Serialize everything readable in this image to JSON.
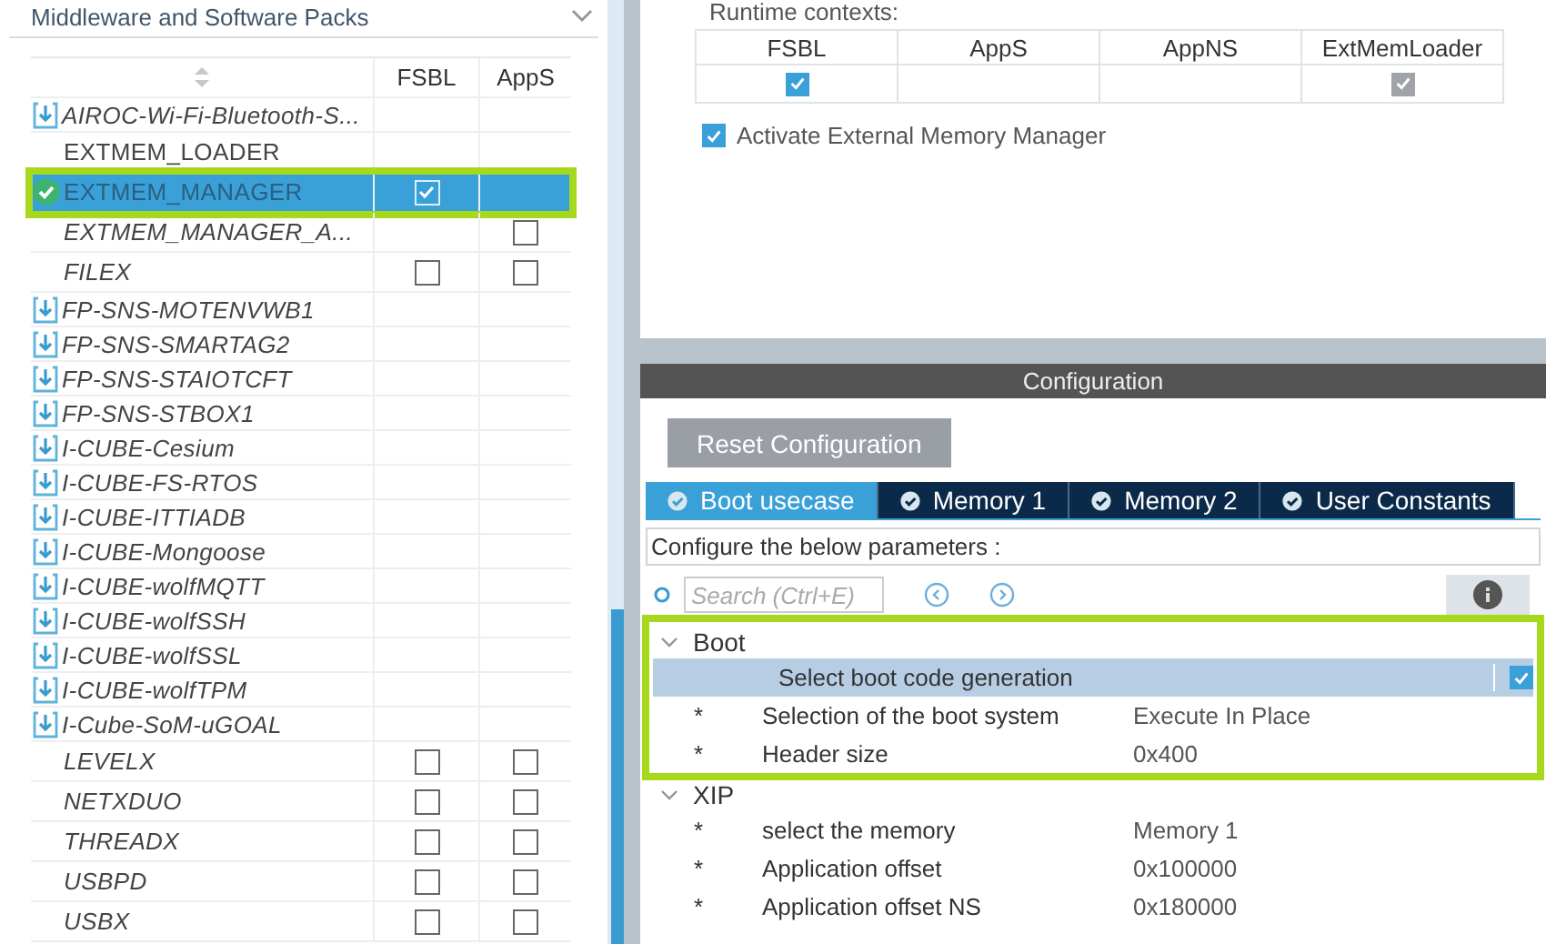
{
  "left_panel": {
    "title": "Middleware and Software Packs",
    "table": {
      "columns": [
        "FSBL",
        "AppS"
      ],
      "rows": [
        {
          "name": "AIROC-Wi-Fi-Bluetooth-S...",
          "kind": "pack",
          "italic": true,
          "selected": false,
          "highlighted": false
        },
        {
          "name": "EXTMEM_LOADER",
          "kind": "component",
          "italic": false,
          "selected": false,
          "highlighted": false
        },
        {
          "name": "EXTMEM_MANAGER",
          "kind": "active_component",
          "italic": false,
          "selected": true,
          "highlighted": true,
          "fsbl_checked": true
        },
        {
          "name": "EXTMEM_MANAGER_A...",
          "kind": "component",
          "italic": true,
          "selected": false,
          "highlighted": false,
          "apps_checked": false
        },
        {
          "name": "FILEX",
          "kind": "component",
          "italic": true,
          "selected": false,
          "highlighted": false,
          "fsbl_checked": false,
          "apps_checked": false
        },
        {
          "name": "FP-SNS-MOTENVWB1",
          "kind": "pack",
          "italic": true,
          "selected": false,
          "highlighted": false
        },
        {
          "name": "FP-SNS-SMARTAG2",
          "kind": "pack",
          "italic": true,
          "selected": false,
          "highlighted": false
        },
        {
          "name": "FP-SNS-STAIOTCFT",
          "kind": "pack",
          "italic": true,
          "selected": false,
          "highlighted": false
        },
        {
          "name": "FP-SNS-STBOX1",
          "kind": "pack",
          "italic": true,
          "selected": false,
          "highlighted": false
        },
        {
          "name": "I-CUBE-Cesium",
          "kind": "pack",
          "italic": true,
          "selected": false,
          "highlighted": false
        },
        {
          "name": "I-CUBE-FS-RTOS",
          "kind": "pack",
          "italic": true,
          "selected": false,
          "highlighted": false
        },
        {
          "name": "I-CUBE-ITTIADB",
          "kind": "pack",
          "italic": true,
          "selected": false,
          "highlighted": false
        },
        {
          "name": "I-CUBE-Mongoose",
          "kind": "pack",
          "italic": true,
          "selected": false,
          "highlighted": false
        },
        {
          "name": "I-CUBE-wolfMQTT",
          "kind": "pack",
          "italic": true,
          "selected": false,
          "highlighted": false
        },
        {
          "name": "I-CUBE-wolfSSH",
          "kind": "pack",
          "italic": true,
          "selected": false,
          "highlighted": false
        },
        {
          "name": "I-CUBE-wolfSSL",
          "kind": "pack",
          "italic": true,
          "selected": false,
          "highlighted": false
        },
        {
          "name": "I-CUBE-wolfTPM",
          "kind": "pack",
          "italic": true,
          "selected": false,
          "highlighted": false
        },
        {
          "name": "I-Cube-SoM-uGOAL",
          "kind": "pack",
          "italic": true,
          "selected": false,
          "highlighted": false
        },
        {
          "name": "LEVELX",
          "kind": "component",
          "italic": true,
          "selected": false,
          "highlighted": false,
          "fsbl_checked": false,
          "apps_checked": false
        },
        {
          "name": "NETXDUO",
          "kind": "component",
          "italic": true,
          "selected": false,
          "highlighted": false,
          "fsbl_checked": false,
          "apps_checked": false
        },
        {
          "name": "THREADX",
          "kind": "component",
          "italic": true,
          "selected": false,
          "highlighted": false,
          "fsbl_checked": false,
          "apps_checked": false
        },
        {
          "name": "USBPD",
          "kind": "component",
          "italic": true,
          "selected": false,
          "highlighted": false,
          "fsbl_checked": false,
          "apps_checked": false
        },
        {
          "name": "USBX",
          "kind": "component",
          "italic": true,
          "selected": false,
          "highlighted": false,
          "fsbl_checked": false,
          "apps_checked": false
        }
      ]
    }
  },
  "runtime": {
    "label": "Runtime contexts:",
    "columns": [
      "FSBL",
      "AppS",
      "AppNS",
      "ExtMemLoader"
    ],
    "cells": [
      {
        "kind": "checkbox",
        "checked": true,
        "disabled": false
      },
      {
        "kind": "empty"
      },
      {
        "kind": "empty"
      },
      {
        "kind": "checkbox",
        "checked": true,
        "disabled": true
      }
    ]
  },
  "activate": {
    "label": "Activate External Memory Manager",
    "checked": true
  },
  "configuration": {
    "title": "Configuration",
    "reset_button": "Reset Configuration",
    "tabs": [
      {
        "label": "Boot usecase",
        "selected": true
      },
      {
        "label": "Memory 1",
        "selected": false
      },
      {
        "label": "Memory 2",
        "selected": false
      },
      {
        "label": "User Constants",
        "selected": false
      }
    ],
    "hint": "Configure the below parameters :",
    "search": {
      "placeholder": "Search (Ctrl+E)"
    },
    "groups": [
      {
        "label": "Boot",
        "expanded": true,
        "highlighted": true,
        "params": [
          {
            "label": "Select boot code generation",
            "kind": "checkbox",
            "checked": true,
            "selected": true
          },
          {
            "marker": "*",
            "label": "Selection of the boot system",
            "kind": "text",
            "value": "Execute In Place",
            "selected": false
          },
          {
            "marker": "*",
            "label": "Header size",
            "kind": "text",
            "value": "0x400",
            "selected": false
          }
        ]
      },
      {
        "label": "XIP",
        "expanded": true,
        "highlighted": false,
        "params": [
          {
            "marker": "*",
            "label": "select the memory",
            "kind": "text",
            "value": "Memory 1",
            "selected": false
          },
          {
            "marker": "*",
            "label": "Application offset",
            "kind": "text",
            "value": "0x100000",
            "selected": false
          },
          {
            "marker": "*",
            "label": "Application offset NS",
            "kind": "text",
            "value": "0x180000",
            "selected": false
          }
        ]
      }
    ]
  }
}
